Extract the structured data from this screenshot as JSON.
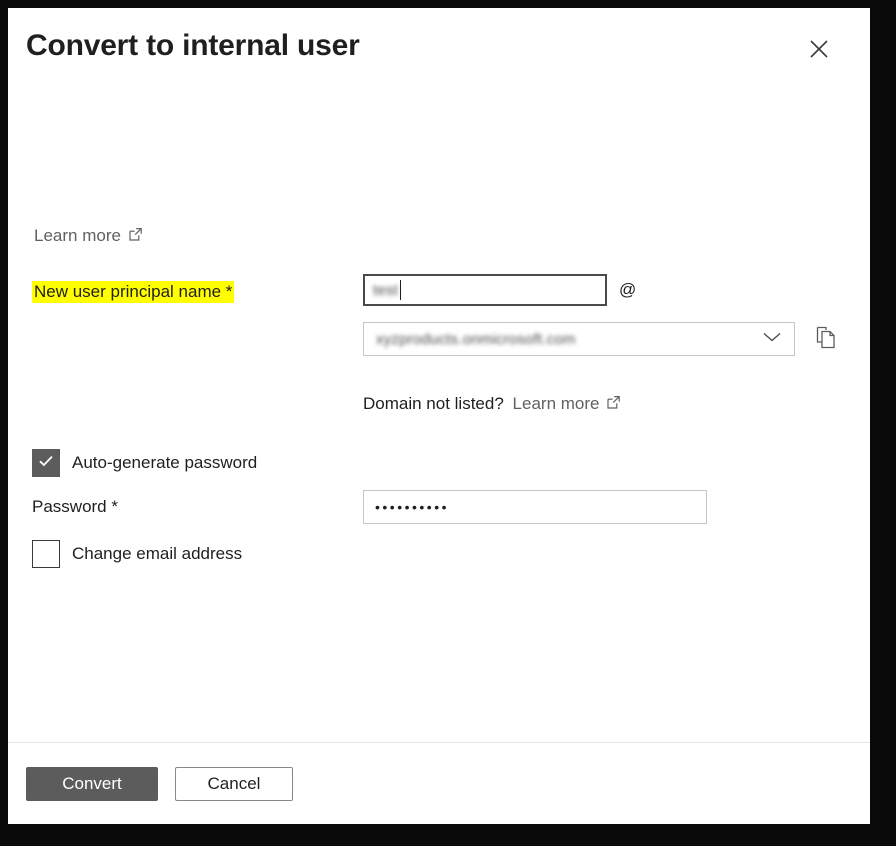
{
  "dialog": {
    "title": "Convert to internal user",
    "close_label": "Close",
    "close_icon": "close-icon"
  },
  "body": {
    "learn_more_link": "Learn more",
    "external_link_icon": "external-link-icon",
    "upn": {
      "label": "New user principal name *",
      "label_highlighted": true,
      "highlight_color": "#ffff00",
      "value": "test",
      "value_redacted": true,
      "at_separator": "@",
      "caret_visible": true
    },
    "domain": {
      "selected": "xyzproducts.onmicrosoft.com",
      "selected_redacted": true,
      "chevron_icon": "chevron-down-icon",
      "copy_icon": "copy-icon",
      "copy_label": "Copy"
    },
    "domain_note": {
      "question": "Domain not listed?",
      "link": "Learn more"
    },
    "auto_generate": {
      "label": "Auto-generate password",
      "checked": true,
      "check_icon": "checkmark-icon"
    },
    "password": {
      "label": "Password *",
      "value": "••••••••••",
      "masked": true
    },
    "change_email": {
      "label": "Change email address",
      "checked": false
    }
  },
  "footer": {
    "primary_label": "Convert",
    "secondary_label": "Cancel",
    "primary_color": "#5c5c5c"
  }
}
